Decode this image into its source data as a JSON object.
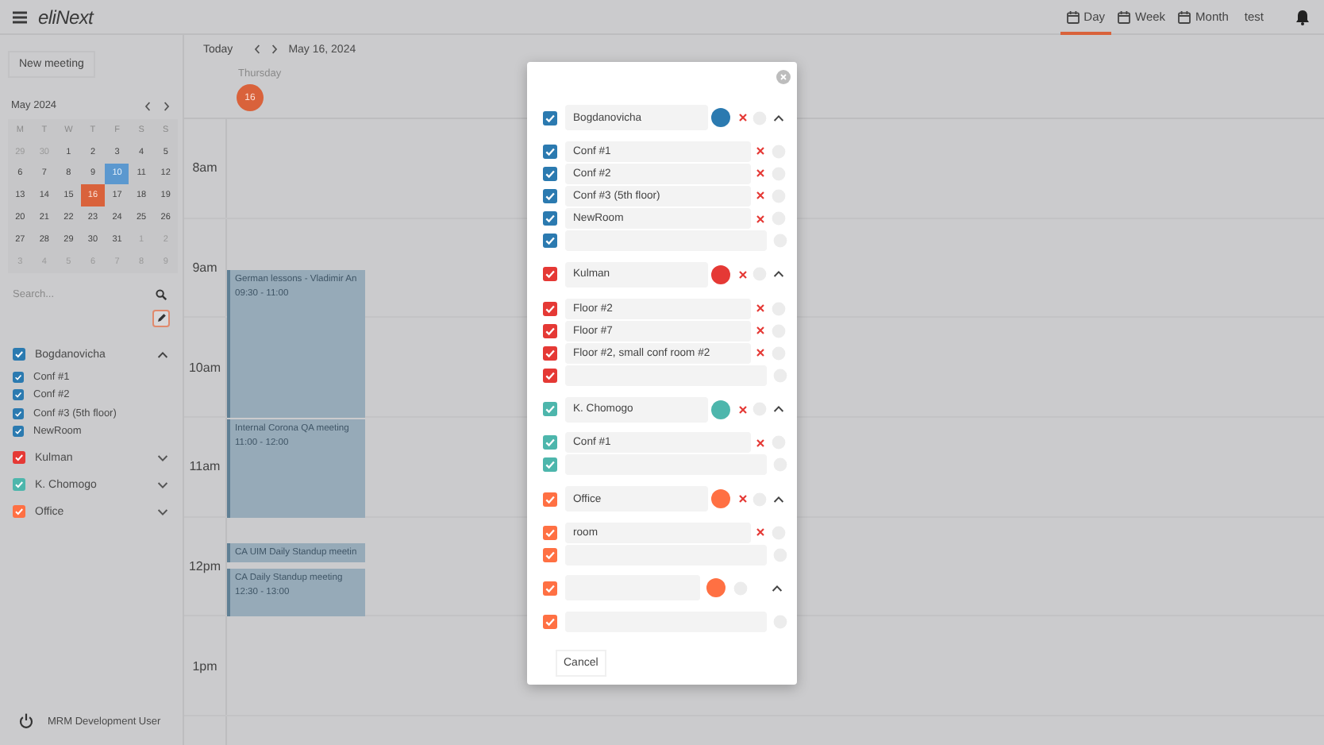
{
  "topbar": {
    "logo": "eliNext",
    "tabs": [
      {
        "label": "Day",
        "selected": true
      },
      {
        "label": "Week",
        "selected": false
      },
      {
        "label": "Month",
        "selected": false
      }
    ],
    "user": "test"
  },
  "sidebar": {
    "new_meeting": "New meeting",
    "mini_calendar": {
      "title": "May 2024",
      "weekdays": [
        "M",
        "T",
        "W",
        "T",
        "F",
        "S",
        "S"
      ],
      "weeks": [
        [
          {
            "day": "29",
            "muted": true,
            "today": false,
            "selected": false
          },
          {
            "day": "30",
            "muted": true,
            "today": false,
            "selected": false
          },
          {
            "day": "1",
            "muted": false,
            "today": false,
            "selected": false
          },
          {
            "day": "2",
            "muted": false,
            "today": false,
            "selected": false
          },
          {
            "day": "3",
            "muted": false,
            "today": false,
            "selected": false
          },
          {
            "day": "4",
            "muted": false,
            "today": false,
            "selected": false
          },
          {
            "day": "5",
            "muted": false,
            "today": false,
            "selected": false
          }
        ],
        [
          {
            "day": "6",
            "muted": false,
            "today": false,
            "selected": false
          },
          {
            "day": "7",
            "muted": false,
            "today": false,
            "selected": false
          },
          {
            "day": "8",
            "muted": false,
            "today": false,
            "selected": false
          },
          {
            "day": "9",
            "muted": false,
            "today": false,
            "selected": false
          },
          {
            "day": "10",
            "muted": false,
            "today": true,
            "selected": false
          },
          {
            "day": "11",
            "muted": false,
            "today": false,
            "selected": false
          },
          {
            "day": "12",
            "muted": false,
            "today": false,
            "selected": false
          }
        ],
        [
          {
            "day": "13",
            "muted": false,
            "today": false,
            "selected": false
          },
          {
            "day": "14",
            "muted": false,
            "today": false,
            "selected": false
          },
          {
            "day": "15",
            "muted": false,
            "today": false,
            "selected": false
          },
          {
            "day": "16",
            "muted": false,
            "today": false,
            "selected": true
          },
          {
            "day": "17",
            "muted": false,
            "today": false,
            "selected": false
          },
          {
            "day": "18",
            "muted": false,
            "today": false,
            "selected": false
          },
          {
            "day": "19",
            "muted": false,
            "today": false,
            "selected": false
          }
        ],
        [
          {
            "day": "20",
            "muted": false,
            "today": false,
            "selected": false
          },
          {
            "day": "21",
            "muted": false,
            "today": false,
            "selected": false
          },
          {
            "day": "22",
            "muted": false,
            "today": false,
            "selected": false
          },
          {
            "day": "23",
            "muted": false,
            "today": false,
            "selected": false
          },
          {
            "day": "24",
            "muted": false,
            "today": false,
            "selected": false
          },
          {
            "day": "25",
            "muted": false,
            "today": false,
            "selected": false
          },
          {
            "day": "26",
            "muted": false,
            "today": false,
            "selected": false
          }
        ],
        [
          {
            "day": "27",
            "muted": false,
            "today": false,
            "selected": false
          },
          {
            "day": "28",
            "muted": false,
            "today": false,
            "selected": false
          },
          {
            "day": "29",
            "muted": false,
            "today": false,
            "selected": false
          },
          {
            "day": "30",
            "muted": false,
            "today": false,
            "selected": false
          },
          {
            "day": "31",
            "muted": false,
            "today": false,
            "selected": false
          },
          {
            "day": "1",
            "muted": true,
            "today": false,
            "selected": false
          },
          {
            "day": "2",
            "muted": true,
            "today": false,
            "selected": false
          }
        ],
        [
          {
            "day": "3",
            "muted": true,
            "today": false,
            "selected": false
          },
          {
            "day": "4",
            "muted": true,
            "today": false,
            "selected": false
          },
          {
            "day": "5",
            "muted": true,
            "today": false,
            "selected": false
          },
          {
            "day": "6",
            "muted": true,
            "today": false,
            "selected": false
          },
          {
            "day": "7",
            "muted": true,
            "today": false,
            "selected": false
          },
          {
            "day": "8",
            "muted": true,
            "today": false,
            "selected": false
          },
          {
            "day": "9",
            "muted": true,
            "today": false,
            "selected": false
          }
        ]
      ]
    },
    "search": {
      "placeholder": "Search..."
    },
    "calendars": [
      {
        "name": "Bogdanovicha",
        "checked": true,
        "color": "#2b7ab0",
        "expanded": true,
        "rooms": [
          {
            "name": "Conf #1",
            "checked": true
          },
          {
            "name": "Conf #2",
            "checked": true
          },
          {
            "name": "Conf #3 (5th floor)",
            "checked": true
          },
          {
            "name": "NewRoom",
            "checked": true
          }
        ]
      },
      {
        "name": "Kulman",
        "checked": true,
        "color": "#e53935",
        "expanded": false
      },
      {
        "name": "K. Chomogo",
        "checked": true,
        "color": "#4db6ac",
        "expanded": false
      },
      {
        "name": "Office",
        "checked": true,
        "color": "#ff7043",
        "expanded": false
      }
    ],
    "footer_user": "MRM Development User"
  },
  "main": {
    "today": "Today",
    "date": "May 16, 2024",
    "day_name": "Thursday",
    "day_number": "16",
    "hours": [
      "8am",
      "9am",
      "10am",
      "11am",
      "12pm",
      "1pm"
    ],
    "events": [
      {
        "title": "German lessons - Vladimir An",
        "time": "09:30 - 11:00"
      },
      {
        "title": "Internal Corona QA meeting",
        "time": "11:00 - 12:00"
      },
      {
        "title": "CA UIM Daily Standup meetin"
      },
      {
        "title": "CA Daily Standup meeting",
        "time": "12:30 - 13:00"
      }
    ]
  },
  "modal": {
    "groups": [
      {
        "kind": "calendar",
        "name": "Bogdanovicha",
        "checked": true,
        "color": "#2b7ab0",
        "expanded": true,
        "rooms": [
          {
            "kind": "room",
            "name": "Conf #1",
            "checked": true
          },
          {
            "kind": "room",
            "name": "Conf #2",
            "checked": true
          },
          {
            "kind": "room",
            "name": "Conf #3 (5th floor)",
            "checked": true
          },
          {
            "kind": "room",
            "name": "NewRoom",
            "checked": true
          },
          {
            "kind": "new",
            "checked": true
          }
        ]
      },
      {
        "kind": "calendar",
        "name": "Kulman",
        "checked": true,
        "color": "#e53935",
        "expanded": true,
        "rooms": [
          {
            "kind": "room",
            "name": "Floor #2",
            "checked": true
          },
          {
            "kind": "room",
            "name": "Floor #7",
            "checked": true
          },
          {
            "kind": "room",
            "name": "Floor #2, small conf room #2",
            "checked": true
          },
          {
            "kind": "new",
            "checked": true
          }
        ]
      },
      {
        "kind": "calendar",
        "name": "K. Chomogo",
        "checked": true,
        "color": "#4db6ac",
        "expanded": true,
        "rooms": [
          {
            "kind": "room",
            "name": "Conf #1",
            "checked": true
          },
          {
            "kind": "new",
            "checked": true
          }
        ]
      },
      {
        "kind": "calendar",
        "name": "Office",
        "checked": true,
        "color": "#ff7043",
        "expanded": true,
        "rooms": [
          {
            "kind": "room",
            "name": "room",
            "checked": true
          },
          {
            "kind": "new",
            "checked": true
          }
        ]
      },
      {
        "kind": "new",
        "checked": true,
        "color": "#ff7043",
        "expanded": true,
        "rooms": [
          {
            "kind": "new",
            "checked": true
          }
        ]
      }
    ],
    "cancel": "Cancel"
  }
}
